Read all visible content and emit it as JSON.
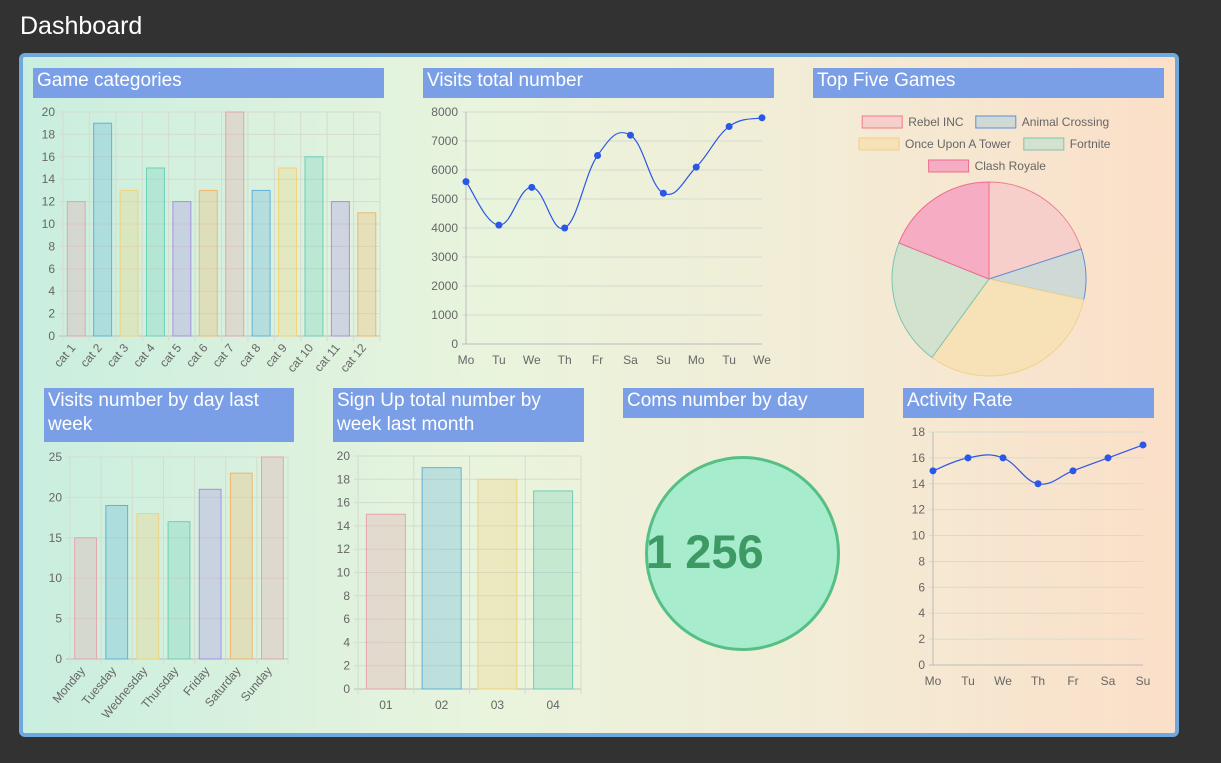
{
  "page": {
    "title": "Dashboard"
  },
  "cards": {
    "game_categories": {
      "title": "Game categories"
    },
    "visits_total": {
      "title": "Visits total number"
    },
    "top_games": {
      "title": "Top Five Games"
    },
    "visits_last_week": {
      "title": "Visits number by day last week"
    },
    "signups_last_month": {
      "title": "Sign Up total number by week last month"
    },
    "coms_by_day": {
      "title": "Coms number by day",
      "value": "1 256"
    },
    "activity_rate": {
      "title": "Activity Rate"
    }
  },
  "chart_data": [
    {
      "id": "game_categories",
      "type": "bar",
      "categories": [
        "cat 1",
        "cat 2",
        "cat 3",
        "cat 4",
        "cat 5",
        "cat 6",
        "cat 7",
        "cat 8",
        "cat 9",
        "cat 10",
        "cat 11",
        "cat 12"
      ],
      "values": [
        12,
        19,
        13,
        15,
        12,
        13,
        20,
        13,
        15,
        16,
        12,
        11
      ],
      "ylim": [
        0,
        20
      ],
      "yticks": [
        0,
        2,
        4,
        6,
        8,
        10,
        12,
        14,
        16,
        18,
        20
      ],
      "colors": [
        "#e6a3ad",
        "#5fb3d9",
        "#f2d27a",
        "#6ccfb9",
        "#a98ee6",
        "#f2b56b",
        "#e6a3ad",
        "#5fb3d9",
        "#f2d27a",
        "#6ccfb9",
        "#a98ee6",
        "#f2b56b"
      ],
      "grid": true
    },
    {
      "id": "visits_total",
      "type": "line",
      "categories": [
        "Mo",
        "Tu",
        "We",
        "Th",
        "Fr",
        "Sa",
        "Su",
        "Mo",
        "Tu",
        "We"
      ],
      "values": [
        5600,
        4100,
        5400,
        4000,
        6500,
        7200,
        5200,
        6100,
        7500,
        7800
      ],
      "ylim": [
        0,
        8000
      ],
      "yticks": [
        0,
        1000,
        2000,
        3000,
        4000,
        5000,
        6000,
        7000,
        8000
      ],
      "color": "#2a57e6",
      "grid": true
    },
    {
      "id": "top_games",
      "type": "pie",
      "labels": [
        "Rebel INC",
        "Animal Crossing",
        "Once Upon A Tower",
        "Fortnite",
        "Clash Royale"
      ],
      "values": [
        19,
        8,
        30,
        20,
        18
      ],
      "fills": [
        "#f6cfcb",
        "#cfdad6",
        "#f7e1b7",
        "#d2e2cf",
        "#f6adc3"
      ],
      "strokes": [
        "#ee7b89",
        "#5b8fd6",
        "#f1d08c",
        "#7fc4ab",
        "#ee6c8d"
      ],
      "legend": "top"
    },
    {
      "id": "visits_last_week",
      "type": "bar",
      "categories": [
        "Monday",
        "Tuesday",
        "Wednesday",
        "Thursday",
        "Friday",
        "Saturday",
        "Sunday"
      ],
      "values": [
        15,
        19,
        18,
        17,
        21,
        23,
        25
      ],
      "ylim": [
        0,
        25
      ],
      "yticks": [
        0,
        5,
        10,
        15,
        20,
        25
      ],
      "colors": [
        "#e6a3ad",
        "#5fb3d9",
        "#f2d27a",
        "#6ccfb9",
        "#a98ee6",
        "#f2b56b",
        "#e6a3ad"
      ],
      "grid": true
    },
    {
      "id": "signups_last_month",
      "type": "bar",
      "categories": [
        "01",
        "02",
        "03",
        "04"
      ],
      "values": [
        15,
        19,
        18,
        17
      ],
      "ylim": [
        0,
        20
      ],
      "yticks": [
        0,
        2,
        4,
        6,
        8,
        10,
        12,
        14,
        16,
        18,
        20
      ],
      "colors": [
        "#e6a3ad",
        "#5fb3d9",
        "#f2d27a",
        "#6ccfb9"
      ],
      "grid": true
    },
    {
      "id": "activity_rate",
      "type": "line",
      "categories": [
        "Mo",
        "Tu",
        "We",
        "Th",
        "Fr",
        "Sa",
        "Su"
      ],
      "values": [
        15,
        16,
        16,
        14,
        15,
        16,
        17
      ],
      "ylim": [
        0,
        18
      ],
      "yticks": [
        0,
        2,
        4,
        6,
        8,
        10,
        12,
        14,
        16,
        18
      ],
      "color": "#2a57e6",
      "grid": true
    }
  ]
}
